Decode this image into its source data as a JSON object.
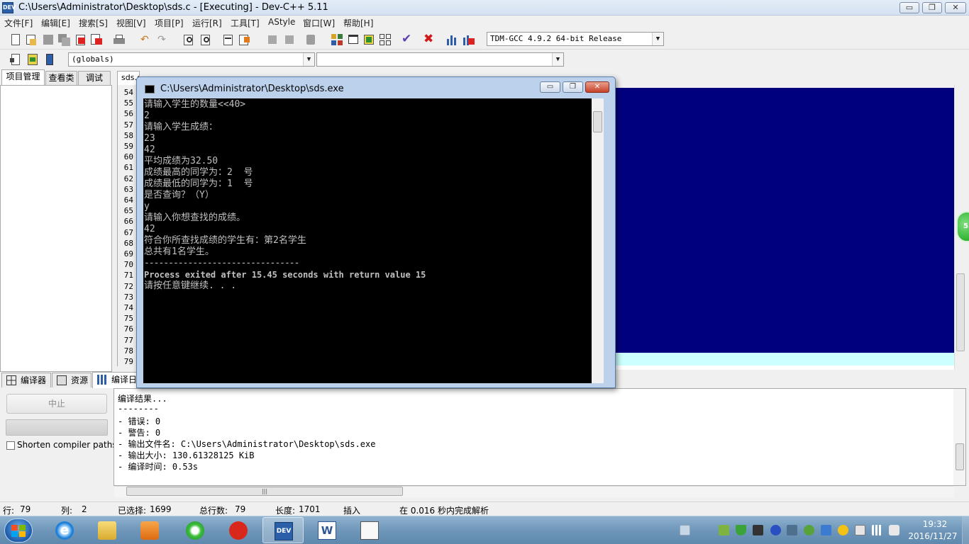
{
  "window": {
    "title": "C:\\Users\\Administrator\\Desktop\\sds.c - [Executing] - Dev-C++ 5.11",
    "app_icon": "DEV",
    "min_glyph": "▭",
    "max_glyph": "❐",
    "close_glyph": "✕"
  },
  "menu": {
    "items": [
      "文件[F]",
      "编辑[E]",
      "搜索[S]",
      "视图[V]",
      "项目[P]",
      "运行[R]",
      "工具[T]",
      "AStyle",
      "窗口[W]",
      "帮助[H]"
    ]
  },
  "toolbar": {
    "compiler_select": "TDM-GCC 4.9.2 64-bit Release",
    "scope_select": "(globals)",
    "symbol_select": ""
  },
  "left_panel": {
    "tabs": [
      "项目管理",
      "查看类",
      "调试"
    ]
  },
  "editor": {
    "tab_label": "sds.c",
    "line_numbers": [
      "54",
      "55",
      "56",
      "57",
      "58",
      "59",
      "60",
      "61",
      "62",
      "63",
      "64",
      "65",
      "66",
      "67",
      "68",
      "69",
      "70",
      "71",
      "72",
      "73",
      "74",
      "75",
      "76",
      "77",
      "78",
      "79"
    ],
    "colors": {
      "background": "#00007f",
      "current_line": "#ccffff"
    }
  },
  "console": {
    "title": "C:\\Users\\Administrator\\Desktop\\sds.exe",
    "lines": [
      "请输入学生的数量<<40>",
      "2",
      "请输入学生成绩：",
      "23",
      "42",
      "平均成绩为32.50",
      "成绩最高的同学为：2  号",
      "成绩最低的同学为：1  号",
      "是否查询？（Y）",
      "y",
      "请输入你想查找的成绩。",
      "42",
      "符合你所查找成绩的学生有：第2名学生",
      "总共有1名学生。",
      "--------------------------------",
      "Process exited after 15.45 seconds with return value 15",
      "请按任意键继续. . ."
    ]
  },
  "bottom": {
    "tabs": [
      "编译器",
      "资源",
      "编译日志"
    ],
    "stop_label": "中止",
    "shorten_label": "Shorten compiler paths",
    "shorten_checked": false,
    "log_lines": [
      "编译结果...",
      "--------",
      "- 错误: 0",
      "- 警告: 0",
      "- 输出文件名: C:\\Users\\Administrator\\Desktop\\sds.exe",
      "- 输出大小: 130.61328125 KiB",
      "- 编译时间: 0.53s"
    ]
  },
  "status": {
    "row_label": "行:",
    "row_value": "79",
    "col_label": "列:",
    "col_value": "2",
    "selected_label": "已选择:",
    "selected_value": "1699",
    "lines_label": "总行数:",
    "lines_value": "79",
    "length_label": "长度:",
    "length_value": "1701",
    "mode": "插入",
    "parse_info": "在 0.016 秒内完成解析"
  },
  "taskbar": {
    "apps": [
      "ie-icon",
      "explorer-icon",
      "media-player-icon",
      "360-browser-icon",
      "netease-music-icon",
      "devcpp-icon",
      "word-icon",
      "notepad-app-icon"
    ],
    "active_app": "devcpp-icon",
    "time": "19:32",
    "date": "2016/11/27"
  }
}
